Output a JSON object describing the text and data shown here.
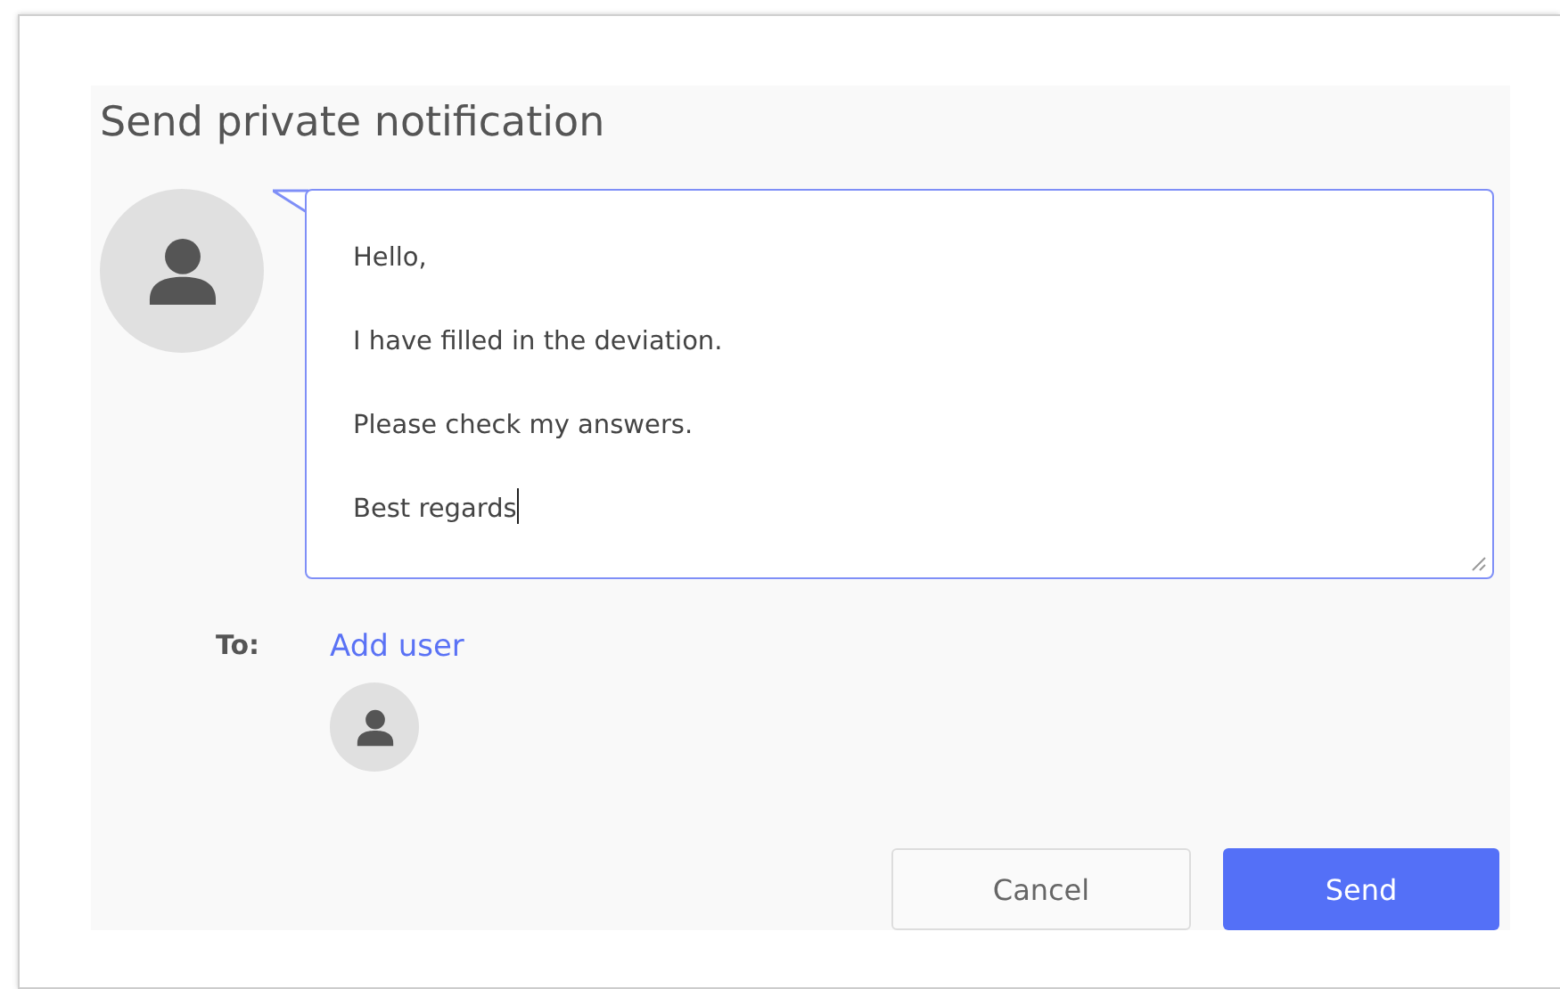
{
  "dialog": {
    "title": "Send private notification"
  },
  "message": {
    "value": "Hello,\nI have filled in the deviation.\nPlease check my answers.\nBest regards"
  },
  "recipients": {
    "label": "To:",
    "add_link": "Add user"
  },
  "buttons": [
    {
      "label": "Cancel",
      "kind": "secondary"
    },
    {
      "label": "Send",
      "kind": "primary"
    }
  ]
}
